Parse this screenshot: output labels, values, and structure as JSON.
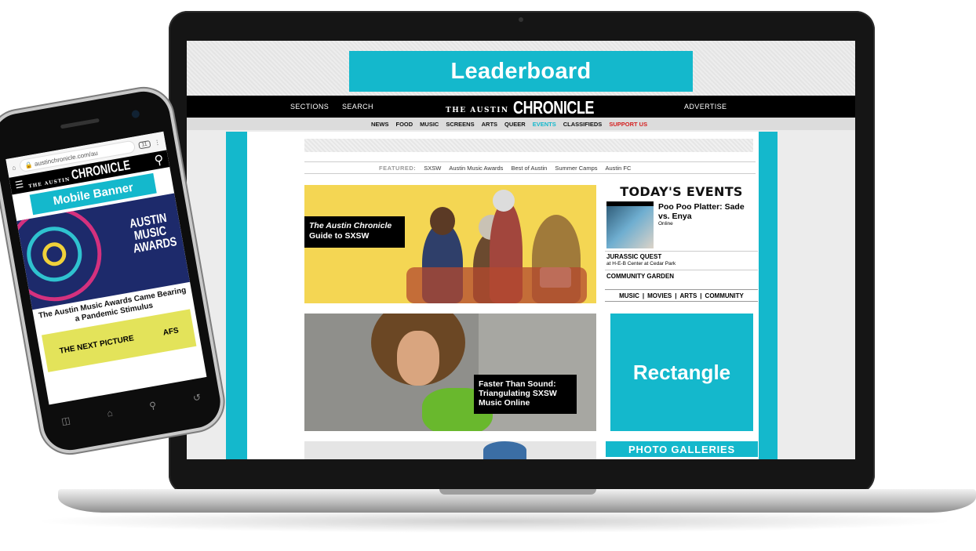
{
  "leaderboard": "Leaderboard",
  "topbar": {
    "sections": "SECTIONS",
    "search": "SEARCH",
    "logo_small": "THE AUSTIN",
    "logo_big": "CHRONICLE",
    "advertise": "ADVERTISE"
  },
  "nav": [
    "NEWS",
    "FOOD",
    "MUSIC",
    "SCREENS",
    "ARTS",
    "QUEER",
    "EVENTS",
    "CLASSIFIEDS",
    "SUPPORT US"
  ],
  "featured": {
    "label": "FEATURED:",
    "items": [
      "SXSW",
      "Austin Music Awards",
      "Best of Austin",
      "Summer Camps",
      "Austin FC"
    ]
  },
  "hero1": {
    "line1": "The Austin Chronicle",
    "line2": "Guide to SXSW"
  },
  "hero2": {
    "line1": "Faster Than Sound:",
    "line2": "Triangulating SXSW",
    "line3": "Music Online"
  },
  "events": {
    "heading": "TODAY'S EVENTS",
    "e1_title": "Poo Poo Platter: Sade vs. Enya",
    "e1_sub": "Online",
    "e2_title": "JURASSIC QUEST",
    "e2_sub": "at H-E-B Center at Cedar Park",
    "e3_title": "COMMUNITY GARDEN",
    "cats": [
      "MUSIC",
      "|",
      "MOVIES",
      "|",
      "ARTS",
      "|",
      "COMMUNITY"
    ]
  },
  "rectangle": "Rectangle",
  "galleries": "PHOTO GALLERIES",
  "phone": {
    "url": "austinchronicle.com/au",
    "tabs": "11",
    "logo_small": "THE AUSTIN",
    "logo_big": "CHRONICLE",
    "banner": "Mobile Banner",
    "art_title": "AUSTIN MUSIC AWARDS",
    "headline": "The Austin Music Awards Came Bearing a Pandemic Stimulus",
    "ad_left": "THE NEXT PICTURE",
    "ad_right": "AFS"
  },
  "colors": {
    "accent": "#14b8cc",
    "support": "#d41f1f",
    "hero1_bg": "#f4d653"
  }
}
